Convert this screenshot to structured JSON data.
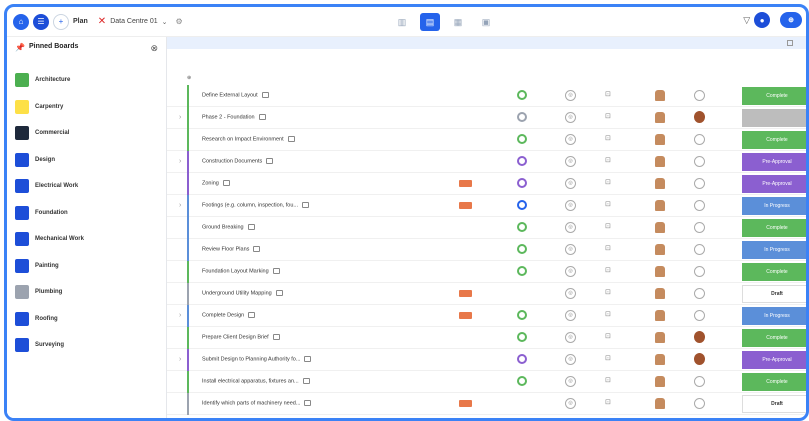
{
  "topbar": {
    "title": "Plan",
    "file": "Data Centre 01"
  },
  "sidebar": {
    "title": "Pinned Boards",
    "boards": [
      {
        "name": "Architecture",
        "color": "#4caf50"
      },
      {
        "name": "Carpentry",
        "color": "#fde047"
      },
      {
        "name": "Commercial",
        "color": "#1e293b"
      },
      {
        "name": "Design",
        "color": "#1d4ed8"
      },
      {
        "name": "Electrical Work",
        "color": "#1d4ed8"
      },
      {
        "name": "Foundation",
        "color": "#1d4ed8"
      },
      {
        "name": "Mechanical Work",
        "color": "#1d4ed8"
      },
      {
        "name": "Painting",
        "color": "#1d4ed8"
      },
      {
        "name": "Plumbing",
        "color": "#9ca3af"
      },
      {
        "name": "Roofing",
        "color": "#1d4ed8"
      },
      {
        "name": "Surveying",
        "color": "#1d4ed8"
      }
    ]
  },
  "colors": {
    "complete": "#5cb85c",
    "gray": "#bdbdbd",
    "approval": "#8b5fd0",
    "progress": "#5b8fd9",
    "blue": "#2563eb",
    "late": "#e8784a"
  },
  "tasks": [
    {
      "name": "Define External Layout",
      "bar": "#5cb85c",
      "ring": "#5cb85c",
      "status": "Complete",
      "stype": "complete",
      "late": false
    },
    {
      "name": "Phase 2 - Foundation",
      "bar": "#5cb85c",
      "ring": "#9ca3af",
      "status": "",
      "stype": "gray",
      "late": false,
      "chev": true,
      "leadAv": true
    },
    {
      "name": "Research on Impact Environment",
      "bar": "#5cb85c",
      "ring": "#5cb85c",
      "status": "Complete",
      "stype": "complete",
      "late": false
    },
    {
      "name": "Construction Documents",
      "bar": "#8b5fd0",
      "ring": "#8b5fd0",
      "status": "Pre-Approval",
      "stype": "approval",
      "late": false,
      "chev": true
    },
    {
      "name": "Zoning",
      "bar": "#8b5fd0",
      "ring": "#8b5fd0",
      "status": "Pre-Approval",
      "stype": "approval",
      "late": true
    },
    {
      "name": "Footings (e.g. column, inspection, fou...",
      "bar": "#5b8fd9",
      "ring": "#2563eb",
      "status": "In Progress",
      "stype": "progress",
      "late": true,
      "chev": true
    },
    {
      "name": "Ground Breaking",
      "bar": "#5b8fd9",
      "ring": "#5cb85c",
      "status": "Complete",
      "stype": "complete",
      "late": false
    },
    {
      "name": "Review Floor Plans",
      "bar": "#5b8fd9",
      "ring": "#5cb85c",
      "status": "In Progress",
      "stype": "progress",
      "late": false
    },
    {
      "name": "Foundation Layout Marking",
      "bar": "#5cb85c",
      "ring": "#5cb85c",
      "status": "Complete",
      "stype": "complete",
      "late": false
    },
    {
      "name": "Underground Utility Mapping",
      "bar": "#9ca3af",
      "ring": "",
      "status": "Draft",
      "stype": "draft",
      "late": true
    },
    {
      "name": "Complete Design",
      "bar": "#5b8fd9",
      "ring": "#5cb85c",
      "status": "In Progress",
      "stype": "progress",
      "late": true,
      "chev": true
    },
    {
      "name": "Prepare Client Design Brief",
      "bar": "#5cb85c",
      "ring": "#5cb85c",
      "status": "Complete",
      "stype": "complete",
      "late": false,
      "leadAv": true
    },
    {
      "name": "Submit Design to Planning Authority fo...",
      "bar": "#8b5fd0",
      "ring": "#8b5fd0",
      "status": "Pre-Approval",
      "stype": "approval",
      "late": false,
      "chev": true,
      "leadAv": true
    },
    {
      "name": "Install electrical apparatus, fixtures an...",
      "bar": "#5cb85c",
      "ring": "#5cb85c",
      "status": "Complete",
      "stype": "complete",
      "late": false
    },
    {
      "name": "Identify which parts of machinery need...",
      "bar": "#9ca3af",
      "ring": "",
      "status": "Draft",
      "stype": "draft",
      "late": true
    }
  ]
}
